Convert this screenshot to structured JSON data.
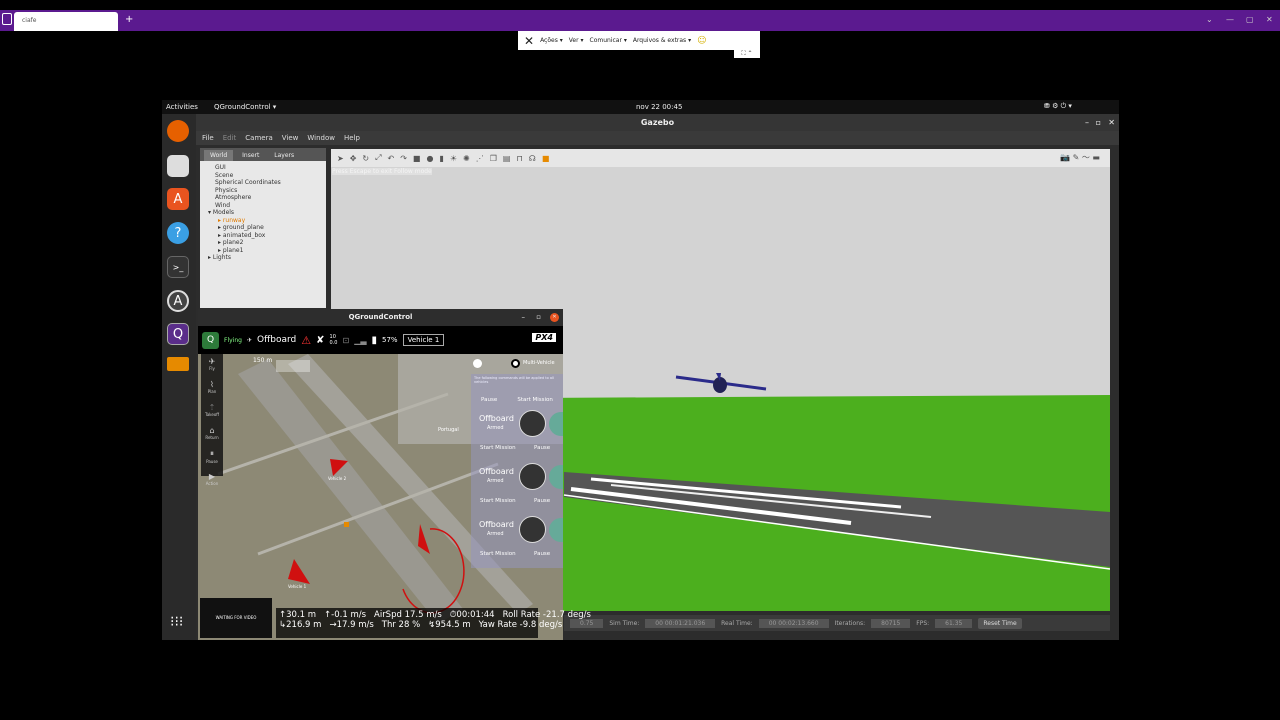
{
  "browser": {
    "tab_title": "ciafe",
    "new_tab": "+",
    "win_controls": [
      "⌄",
      "—",
      "▢",
      "✕"
    ]
  },
  "ext_toolbar": {
    "close": "✕",
    "items": [
      "Ações ▾",
      "Ver ▾",
      "Comunicar ▾",
      "Arquivos & extras ▾"
    ],
    "emoji": "☺",
    "mini": "⛶ ⌃"
  },
  "topbar": {
    "activities": "Activities",
    "app": "QGroundControl ▾",
    "clock": "nov 22  00:45",
    "tray": "⛃  ⚙  ⏻ ▾"
  },
  "dock": {
    "grid": "⁝⁝⁝"
  },
  "gazebo": {
    "title": "Gazebo",
    "win_controls": [
      "–",
      "▫",
      "✕"
    ],
    "menu": [
      "File",
      "Edit",
      "Camera",
      "View",
      "Window",
      "Help"
    ],
    "tabs": [
      "World",
      "Insert",
      "Layers"
    ],
    "tree": [
      "GUI",
      "Scene",
      "Spherical Coordinates",
      "Physics",
      "Atmosphere",
      "Wind",
      "▾ Models",
      "▸ runway",
      "▸ ground_plane",
      "▸ animated_box",
      "▸ plane2",
      "▸ plane1",
      "▸ Lights"
    ],
    "hint": "Press Escape to exit Follow mode",
    "status": {
      "real_time_factor": "0.75",
      "sim_time_label": "Sim Time:",
      "sim_time": "00 00:01:21.036",
      "real_time_label": "Real Time:",
      "real_time": "00 00:02:13.660",
      "iterations_label": "Iterations:",
      "iterations": "80715",
      "fps_label": "FPS:",
      "fps": "61.35",
      "reset": "Reset Time"
    }
  },
  "qgc": {
    "title": "QGroundControl",
    "win_controls": [
      "–",
      "▫",
      "✕"
    ],
    "flying": "Flying",
    "mode": "Offboard",
    "satellites": "10",
    "hdop": "0.0",
    "battery": "57%",
    "vehicle": "Vehicle 1",
    "brand": "PX4",
    "tools": [
      "Fly",
      "Plan",
      "Takeoff",
      "Return",
      "Pause",
      "Action"
    ],
    "scale": "150 m",
    "map_labels": [
      "Portugal",
      "Vehicle 2",
      "Vehicle 1"
    ],
    "panel": {
      "option": "Multi-Vehicle",
      "note": "The following commands will be applied to all vehicles",
      "top_buttons": [
        "Pause",
        "Start Mission"
      ],
      "vehicles": [
        {
          "mode": "Offboard",
          "state": "Armed",
          "buttons": [
            "Start Mission",
            "Pause"
          ]
        },
        {
          "mode": "Offboard",
          "state": "Armed",
          "buttons": [
            "Start Mission",
            "Pause"
          ]
        },
        {
          "mode": "Offboard",
          "state": "Armed",
          "buttons": [
            "Start Mission",
            "Pause"
          ]
        }
      ]
    },
    "video": "WAITING FOR VIDEO",
    "telemetry": {
      "row1": [
        "↑30.1 m",
        "↑-0.1 m/s",
        "AirSpd 17.5 m/s",
        "⏱00:01:44",
        "Roll Rate -21.7 deg/s"
      ],
      "row2": [
        "↳216.9 m",
        "→17.9 m/s",
        "Thr 28 %",
        "↯954.5 m",
        "Yaw Rate -9.8 deg/s"
      ]
    }
  }
}
